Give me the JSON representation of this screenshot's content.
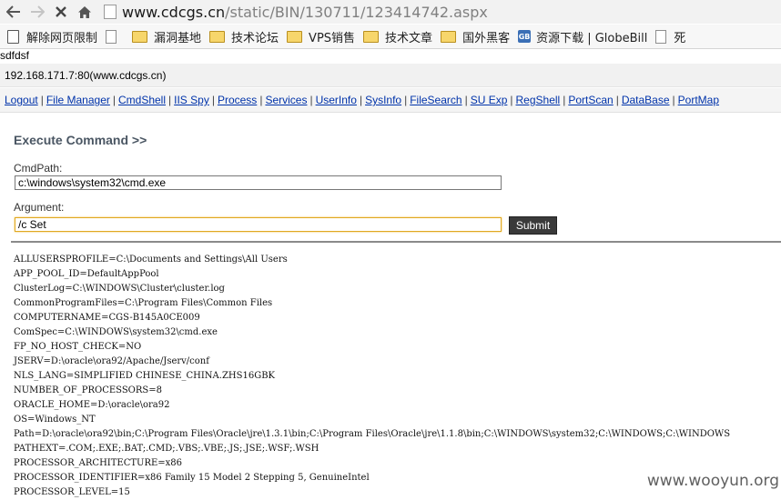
{
  "browser": {
    "url_host": "www.cdcgs.cn",
    "url_path": "/static/BIN/130711/123414742.aspx",
    "bookmarks": [
      {
        "label": "解除网页限制",
        "icon": "bookmarklet-icon"
      },
      {
        "label": "",
        "icon": "page-icon"
      },
      {
        "label": "漏洞基地",
        "icon": "folder-icon"
      },
      {
        "label": "技术论坛",
        "icon": "folder-icon"
      },
      {
        "label": "VPS销售",
        "icon": "folder-icon"
      },
      {
        "label": "技术文章",
        "icon": "folder-icon"
      },
      {
        "label": "国外黑客",
        "icon": "folder-icon"
      },
      {
        "label": "资源下载 | GlobeBill",
        "icon": "globebill-icon"
      },
      {
        "label": "死",
        "icon": "page-icon"
      }
    ],
    "gb_icon_text": "GB"
  },
  "page": {
    "top_text": "sdfdsf",
    "server_info": "192.168.171.7:80(www.cdcgs.cn)",
    "menu": [
      "Logout",
      "File Manager",
      "CmdShell",
      "IIS Spy",
      "Process",
      "Services",
      "UserInfo",
      "SysInfo",
      "FileSearch",
      "SU Exp",
      "RegShell",
      "PortScan",
      "DataBase",
      "PortMap"
    ],
    "section_title": "Execute Command >>",
    "cmdpath_label": "CmdPath:",
    "cmdpath_value": "c:\\windows\\system32\\cmd.exe",
    "argument_label": "Argument:",
    "argument_value": "/c Set",
    "submit_label": "Submit",
    "output_lines": [
      "ALLUSERSPROFILE=C:\\Documents and Settings\\All Users",
      "APP_POOL_ID=DefaultAppPool",
      "ClusterLog=C:\\WINDOWS\\Cluster\\cluster.log",
      "CommonProgramFiles=C:\\Program Files\\Common Files",
      "COMPUTERNAME=CGS-B145A0CE009",
      "ComSpec=C:\\WINDOWS\\system32\\cmd.exe",
      "FP_NO_HOST_CHECK=NO",
      "JSERV=D:\\oracle\\ora92/Apache/Jserv/conf",
      "NLS_LANG=SIMPLIFIED CHINESE_CHINA.ZHS16GBK",
      "NUMBER_OF_PROCESSORS=8",
      "ORACLE_HOME=D:\\oracle\\ora92",
      "OS=Windows_NT",
      "Path=D:\\oracle\\ora92\\bin;C:\\Program Files\\Oracle\\jre\\1.3.1\\bin;C:\\Program Files\\Oracle\\jre\\1.1.8\\bin;C:\\WINDOWS\\system32;C:\\WINDOWS;C:\\WINDOWS",
      "PATHEXT=.COM;.EXE;.BAT;.CMD;.VBS;.VBE;.JS;.JSE;.WSF;.WSH",
      "PROCESSOR_ARCHITECTURE=x86",
      "PROCESSOR_IDENTIFIER=x86 Family 15 Model 2 Stepping 5, GenuineIntel",
      "PROCESSOR_LEVEL=15"
    ],
    "watermark": "www.wooyun.org"
  }
}
